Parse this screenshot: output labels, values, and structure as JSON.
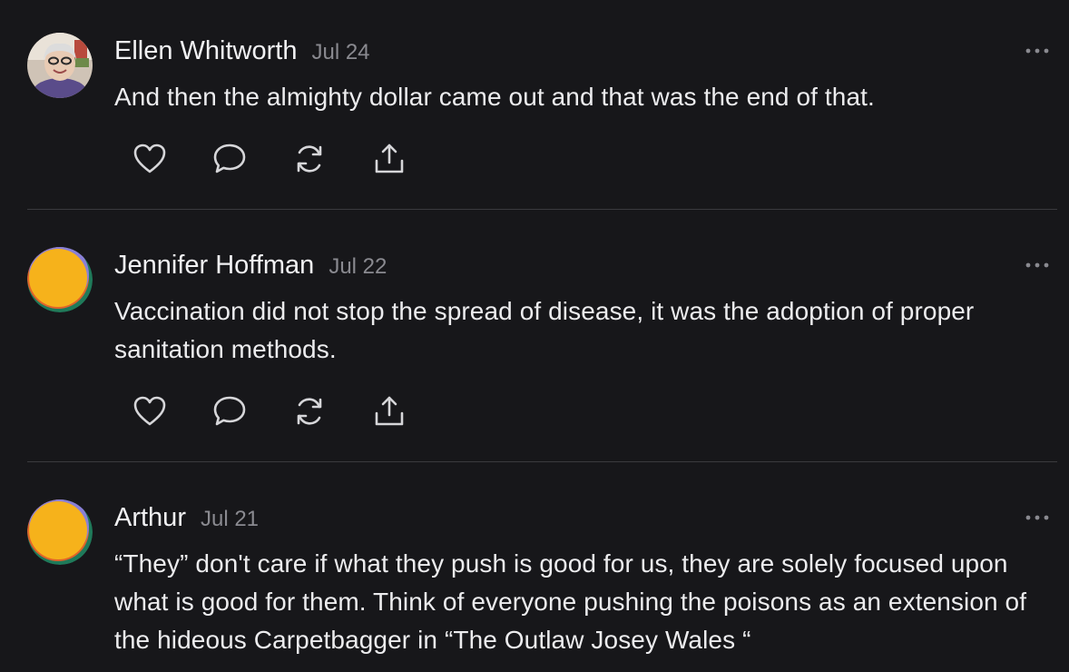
{
  "comments": [
    {
      "author": "Ellen Whitworth",
      "date": "Jul 24",
      "text": "And then the almighty dollar came out and that was the end of that.",
      "avatar": "photo"
    },
    {
      "author": "Jennifer Hoffman",
      "date": "Jul 22",
      "text": "Vaccination did not stop the spread of disease, it was the adoption of proper sanitation methods.",
      "avatar": "default"
    },
    {
      "author": "Arthur",
      "date": "Jul 21",
      "text": "“They” don't care if what they push is good for us, they are solely focused upon what is good for them. Think of everyone pushing the poisons as an extension of the hideous Carpetbagger in “The Outlaw Josey Wales “",
      "avatar": "default"
    }
  ],
  "icons": {
    "like": "heart-icon",
    "reply": "speech-bubble-icon",
    "restack": "repost-icon",
    "share": "share-icon",
    "more": "ellipsis-icon"
  },
  "colors": {
    "background": "#17171a",
    "text": "#ececee",
    "muted": "#8a8a90",
    "divider": "#3a3a3e",
    "avatar_yellow": "#f6b21b",
    "avatar_green": "#1f7a5a",
    "avatar_orange": "#e0632a",
    "avatar_purple": "#8a7fd6"
  }
}
